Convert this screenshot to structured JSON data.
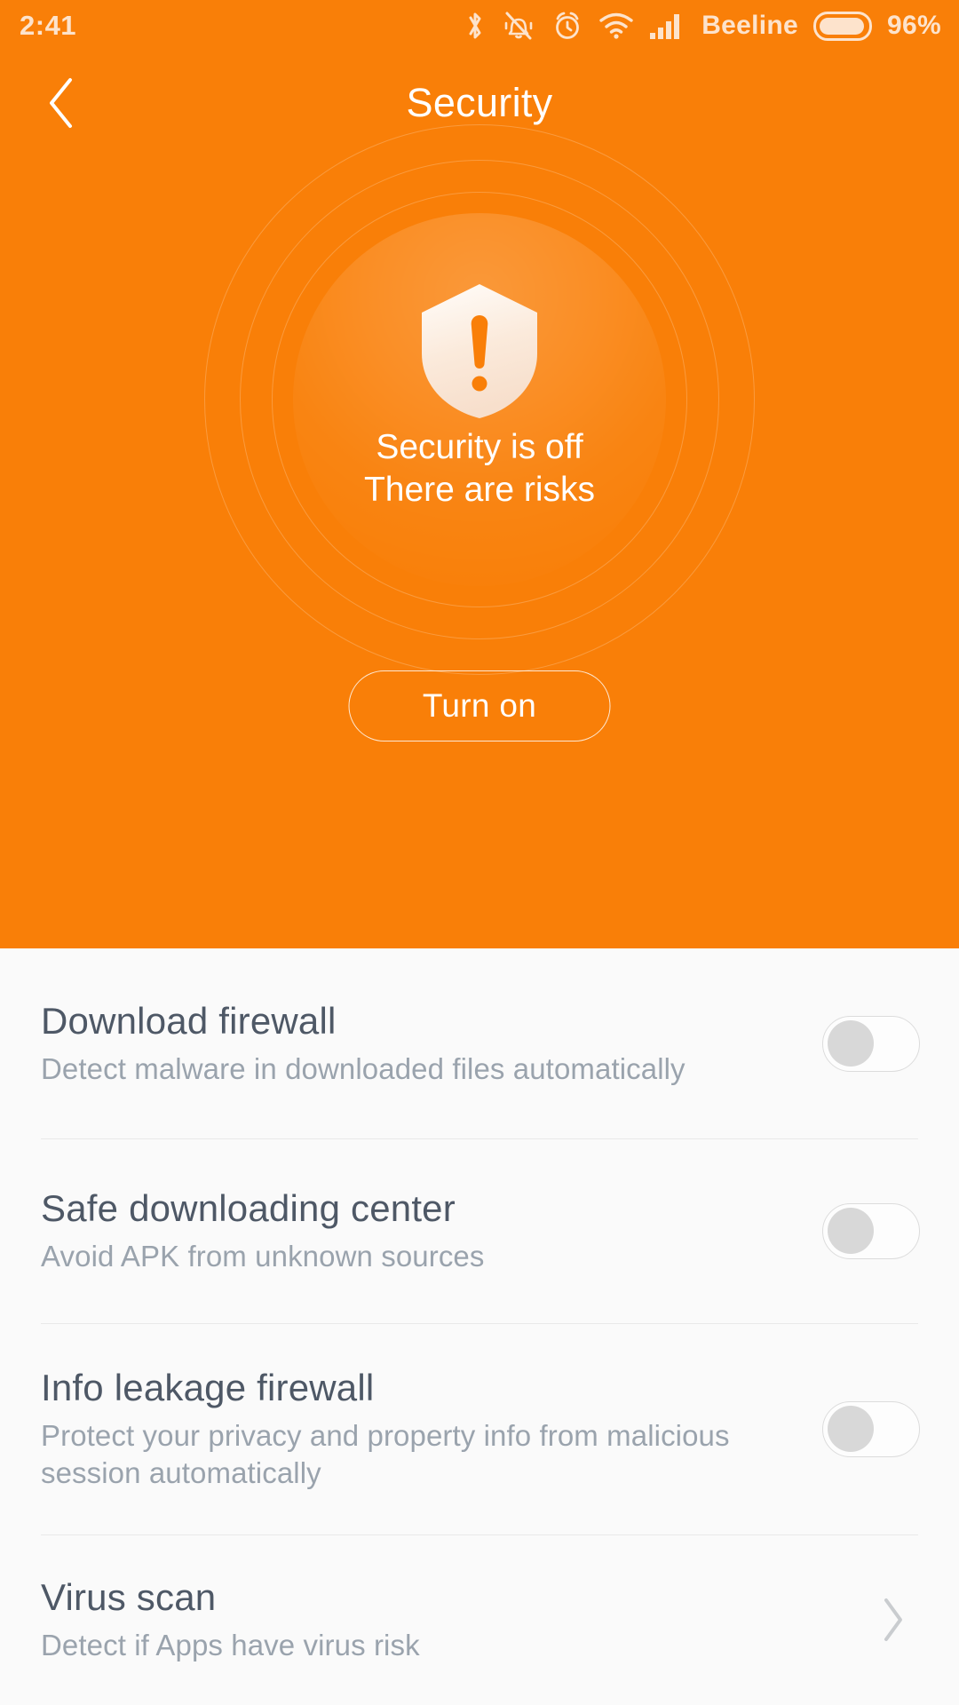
{
  "status_bar": {
    "time": "2:41",
    "carrier": "Beeline",
    "battery_percent": "96%",
    "icons": [
      "bluetooth-icon",
      "vibrate-mute-icon",
      "alarm-clock-icon",
      "wifi-icon",
      "cellular-signal-icon",
      "battery-icon"
    ]
  },
  "header": {
    "title": "Security",
    "back_icon": "chevron-left-icon"
  },
  "hero": {
    "shield_icon": "shield-exclamation-icon",
    "status_line_1": "Security is off",
    "status_line_2": "There are risks",
    "turn_on_label": "Turn on",
    "accent_color": "#F97F08",
    "shield_color": "#FBE9DA",
    "text_color": "#FFFFFF"
  },
  "settings": {
    "rows": [
      {
        "title": "Download firewall",
        "subtitle": "Detect malware in downloaded files automatically",
        "control": "toggle",
        "state": "off"
      },
      {
        "title": "Safe downloading center",
        "subtitle": "Avoid APK from unknown sources",
        "control": "toggle",
        "state": "off"
      },
      {
        "title": "Info leakage firewall",
        "subtitle": "Protect your privacy and property info from malicious session automatically",
        "control": "toggle",
        "state": "off"
      },
      {
        "title": "Virus scan",
        "subtitle": "Detect if Apps have virus risk",
        "control": "chevron",
        "state": ""
      }
    ],
    "background_color": "#FAFAFA",
    "title_color": "#4E5866",
    "subtitle_color": "#9AA3AD"
  }
}
